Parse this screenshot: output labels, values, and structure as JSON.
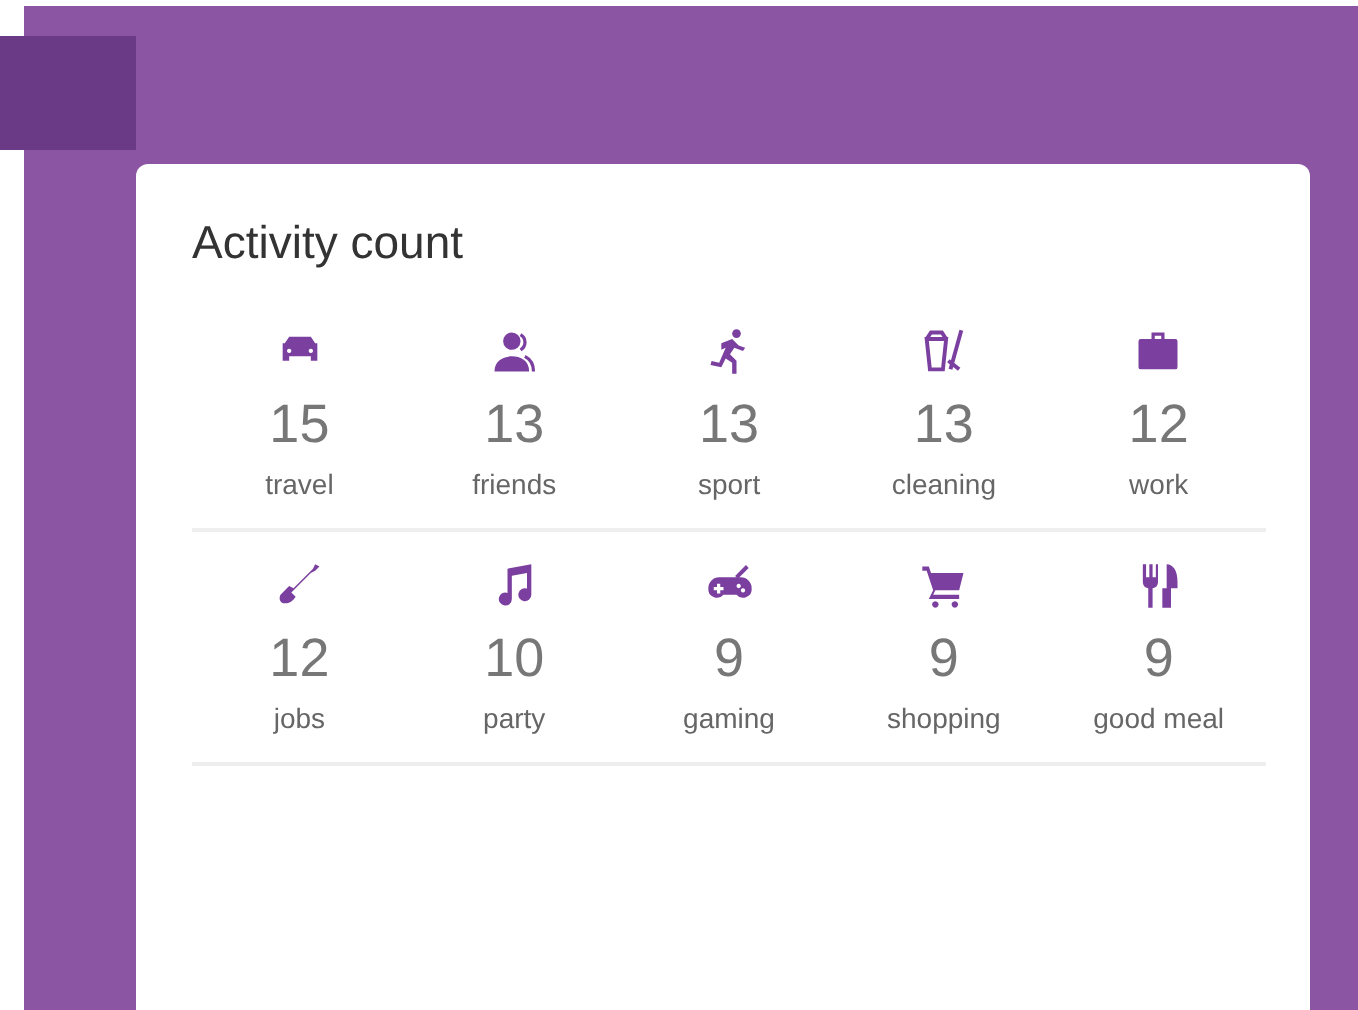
{
  "card": {
    "title": "Activity count"
  },
  "rows": [
    [
      {
        "kind": "car",
        "count": "15",
        "label": "travel"
      },
      {
        "kind": "people",
        "count": "13",
        "label": "friends"
      },
      {
        "kind": "runner",
        "count": "13",
        "label": "sport"
      },
      {
        "kind": "bucket",
        "count": "13",
        "label": "cleaning"
      },
      {
        "kind": "briefcase",
        "count": "12",
        "label": "work"
      }
    ],
    [
      {
        "kind": "shovel",
        "count": "12",
        "label": "jobs"
      },
      {
        "kind": "note",
        "count": "10",
        "label": "party"
      },
      {
        "kind": "gamepad",
        "count": "9",
        "label": "gaming"
      },
      {
        "kind": "cart",
        "count": "9",
        "label": "shopping"
      },
      {
        "kind": "cutlery",
        "count": "9",
        "label": "good meal"
      }
    ]
  ]
}
